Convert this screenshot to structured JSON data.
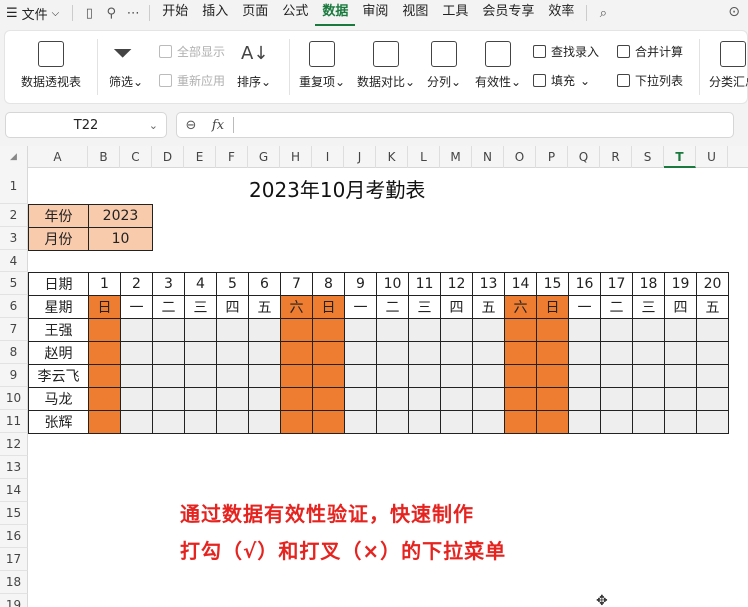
{
  "menu": {
    "file_label": "文件",
    "tabs": [
      {
        "label": "开始",
        "active": false
      },
      {
        "label": "插入",
        "active": false
      },
      {
        "label": "页面",
        "active": false
      },
      {
        "label": "公式",
        "active": false
      },
      {
        "label": "数据",
        "active": true
      },
      {
        "label": "审阅",
        "active": false
      },
      {
        "label": "视图",
        "active": false
      },
      {
        "label": "工具",
        "active": false
      },
      {
        "label": "会员专享",
        "active": false
      },
      {
        "label": "效率",
        "active": false
      }
    ]
  },
  "ribbon": {
    "pivot": "数据透视表",
    "filter": "筛选",
    "show_all": "全部显示",
    "reapply": "重新应用",
    "sort": "排序",
    "duplicates": "重复项",
    "compare": "数据对比",
    "split": "分列",
    "validity": "有效性",
    "find_entry": "查找录入",
    "fill": "填充",
    "consolidate": "合并计算",
    "dropdown_list": "下拉列表",
    "subtotal": "分类汇总"
  },
  "formula_bar": {
    "cell_ref": "T22",
    "fx_label": "fx",
    "value": ""
  },
  "columns": [
    "A",
    "B",
    "C",
    "D",
    "E",
    "F",
    "G",
    "H",
    "I",
    "J",
    "K",
    "L",
    "M",
    "N",
    "O",
    "P",
    "Q",
    "R",
    "S",
    "T",
    "U"
  ],
  "selected_column": "T",
  "rows": [
    "1",
    "2",
    "3",
    "4",
    "5",
    "6",
    "7",
    "8",
    "9",
    "10",
    "11",
    "12",
    "13",
    "14",
    "15",
    "16",
    "17",
    "18",
    "19"
  ],
  "sheet": {
    "title": "2023年10月考勤表",
    "year_label": "年份",
    "year_value": "2023",
    "month_label": "月份",
    "month_value": "10",
    "date_label": "日期",
    "weekday_label": "星期",
    "days": [
      "1",
      "2",
      "3",
      "4",
      "5",
      "6",
      "7",
      "8",
      "9",
      "10",
      "11",
      "12",
      "13",
      "14",
      "15",
      "16",
      "17",
      "18",
      "19",
      "20"
    ],
    "weekdays": [
      "日",
      "一",
      "二",
      "三",
      "四",
      "五",
      "六",
      "日",
      "一",
      "二",
      "三",
      "四",
      "五",
      "六",
      "日",
      "一",
      "二",
      "三",
      "四",
      "五"
    ],
    "weekend_flags": [
      true,
      false,
      false,
      false,
      false,
      false,
      true,
      true,
      false,
      false,
      false,
      false,
      false,
      true,
      true,
      false,
      false,
      false,
      false,
      false
    ],
    "employees": [
      "王强",
      "赵明",
      "李云飞",
      "马龙",
      "张辉"
    ]
  },
  "annotation": {
    "line1": "通过数据有效性验证，快速制作",
    "line2": "打勾（√）和打叉（×）的下拉菜单"
  },
  "colors": {
    "weekend": "#ef7d31",
    "header_fill": "#f8cbad",
    "blank_cell": "#eeeeee",
    "accent": "#1a7a3e",
    "note": "#e52420"
  }
}
